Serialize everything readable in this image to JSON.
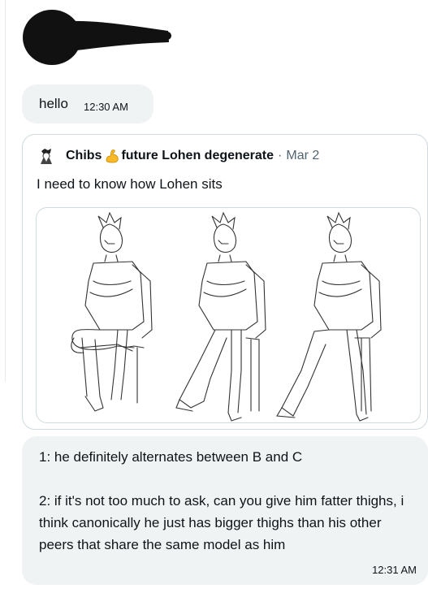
{
  "messages": {
    "hello": {
      "text": "hello",
      "time": "12:30 AM"
    },
    "quoted_post": {
      "author_name_before": "Chibs",
      "author_emoji": "flexed-biceps-icon",
      "author_name_after": "future Lohen degenerate",
      "separator": "·",
      "date": "Mar 2",
      "text": "I need to know how Lohen sits",
      "image_description_icon": "sketch-image"
    },
    "reply": {
      "paragraph1": "1: he definitely alternates between B and C",
      "paragraph2": "2: if it's not too much to ask, can you give him fatter thighs, i think canonically he just has bigger thighs than his other peers that share the same model as him",
      "time": "12:31 AM"
    }
  },
  "colors": {
    "bubble_bg": "#eff3f4",
    "text": "#0f1419",
    "muted": "#536471",
    "border": "#cfd9de",
    "redaction": "#111111",
    "emoji": "#f7b928"
  }
}
